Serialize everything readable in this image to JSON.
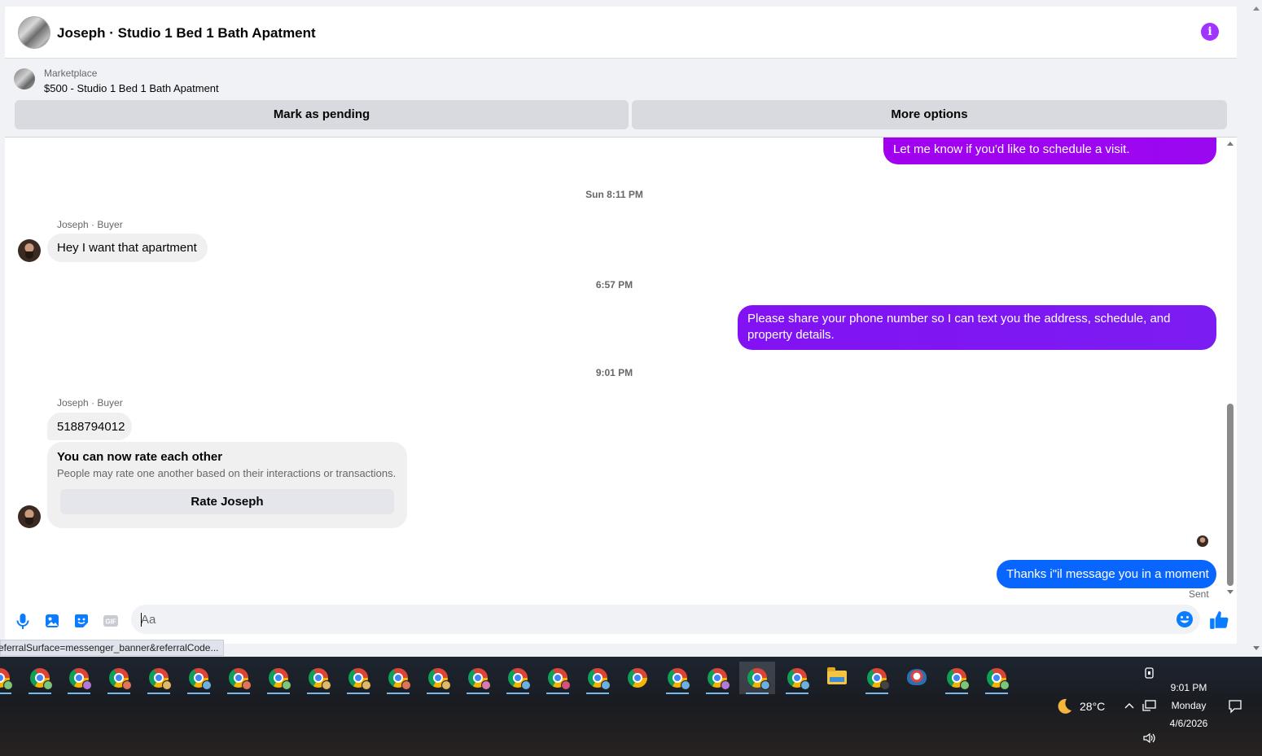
{
  "header": {
    "title": "Joseph · Studio 1 Bed 1 Bath Apatment"
  },
  "marketplace": {
    "label": "Marketplace",
    "item": "$500 - Studio 1 Bed 1 Bath Apatment",
    "pending_button": "Mark as pending",
    "more_button": "More options"
  },
  "messages": {
    "top_partial": "Let me know if you'd like to schedule a visit.",
    "ts1": "Sun 8:11 PM",
    "sender1": "Joseph · Buyer",
    "msg1": "Hey I want that apartment",
    "ts2": "6:57 PM",
    "outgoing1": "Please share your phone number so I can text you the address, schedule, and property details.",
    "ts3": "9:01 PM",
    "sender2": "Joseph · Buyer",
    "msg2": "5188794012",
    "rating_title": "You can now rate each other",
    "rating_sub": "People may rate one another based on their interactions or transactions.",
    "rating_button": "Rate Joseph",
    "outgoing2": "Thanks i\"il message you in a moment",
    "sent_status": "Sent"
  },
  "composer": {
    "placeholder": "Aa"
  },
  "status_bar": {
    "url": "eferralSurface=messenger_banner&referralCode..."
  },
  "taskbar": {
    "weather_temp": "28°C",
    "time": "9:01 PM",
    "day": "Monday",
    "date": "4/6/2026"
  },
  "colors": {
    "accent_purple": "#a033ff",
    "outgoing_gradient_1": "#a100ef",
    "outgoing_gradient_2": "#7e1af2",
    "outgoing_blue": "#0866ff",
    "composer_icon": "#0a7cff"
  },
  "icons": [
    "info-icon",
    "microphone-icon",
    "image-icon",
    "sticker-icon",
    "gif-icon",
    "emoji-icon",
    "thumbs-up-icon",
    "chrome-icon",
    "folder-icon",
    "moon-icon",
    "chevron-up-icon",
    "network-icon",
    "volume-icon",
    "notification-icon",
    "meet-now-icon"
  ]
}
